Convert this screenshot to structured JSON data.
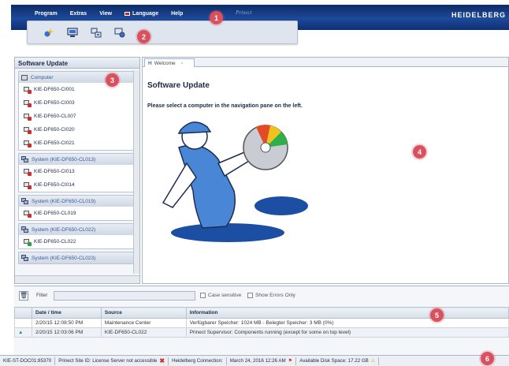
{
  "menu": {
    "items": [
      "Program",
      "Extras",
      "View",
      "Language",
      "Help"
    ],
    "prinect_logo": "Prinect",
    "brand": "HEIDELBERG"
  },
  "toolbar": {
    "buttons": [
      "update-wizard-icon",
      "monitor-icon",
      "network-computer-icon",
      "computer-settings-icon"
    ]
  },
  "left_panel": {
    "title": "Software Update",
    "groups": [
      {
        "label": "Computer",
        "icon": "computer-icon",
        "items": [
          "KIE-DF650-CI001",
          "KIE-DF650-CI003",
          "KIE-DF650-CL007",
          "KIE-DF650-CI020",
          "KIE-DF650-CI021"
        ]
      },
      {
        "label": "System (KIE-DF650-CL013)",
        "icon": "system-icon",
        "items": [
          "KIE-DF650-CI013",
          "KIE-DF650-CI014"
        ]
      },
      {
        "label": "System (KIE-DF650-CL019)",
        "icon": "system-icon",
        "items": [
          "KIE-DF650-CL019"
        ]
      },
      {
        "label": "System (KIE-DF650-CL022)",
        "icon": "system-icon",
        "items": [
          "KIE-DF650-CL022"
        ]
      },
      {
        "label": "System (KIE-DF650-CL023)",
        "icon": "system-icon",
        "items": []
      }
    ]
  },
  "main": {
    "tab_label": "Welcome",
    "title": "Software Update",
    "message": "Please select a computer in the navigation pane on the left."
  },
  "log": {
    "filter_label": "Filter",
    "filter_placeholder": "",
    "case_sensitive_label": "Case sensitive",
    "show_errors_label": "Show Errors Only",
    "columns": [
      "Date / time",
      "Source",
      "Information"
    ],
    "rows": [
      {
        "datetime": "2/20/15 12:08:50 PM",
        "source": "Maintenance Center",
        "info": "Verfügbarer Speicher: 1024 MB - Belegter Speicher: 3 MB (0%)"
      },
      {
        "datetime": "2/20/15 12:03:06 PM",
        "source": "KIE-DF650-CL022",
        "info": "Prinect Supervisor: Components running (except for some on top level)"
      }
    ]
  },
  "status": {
    "host": "KIE-ST-DOC01:85370",
    "license": "Prinect Site ID: License Server not accessible",
    "connection": "Heidelberg Connection:",
    "datetime": "March 24, 2016 12:26 AM",
    "disk": "Available Disk Space: 17.22 GB"
  },
  "callouts": [
    "1",
    "2",
    "3",
    "4",
    "5",
    "6"
  ]
}
